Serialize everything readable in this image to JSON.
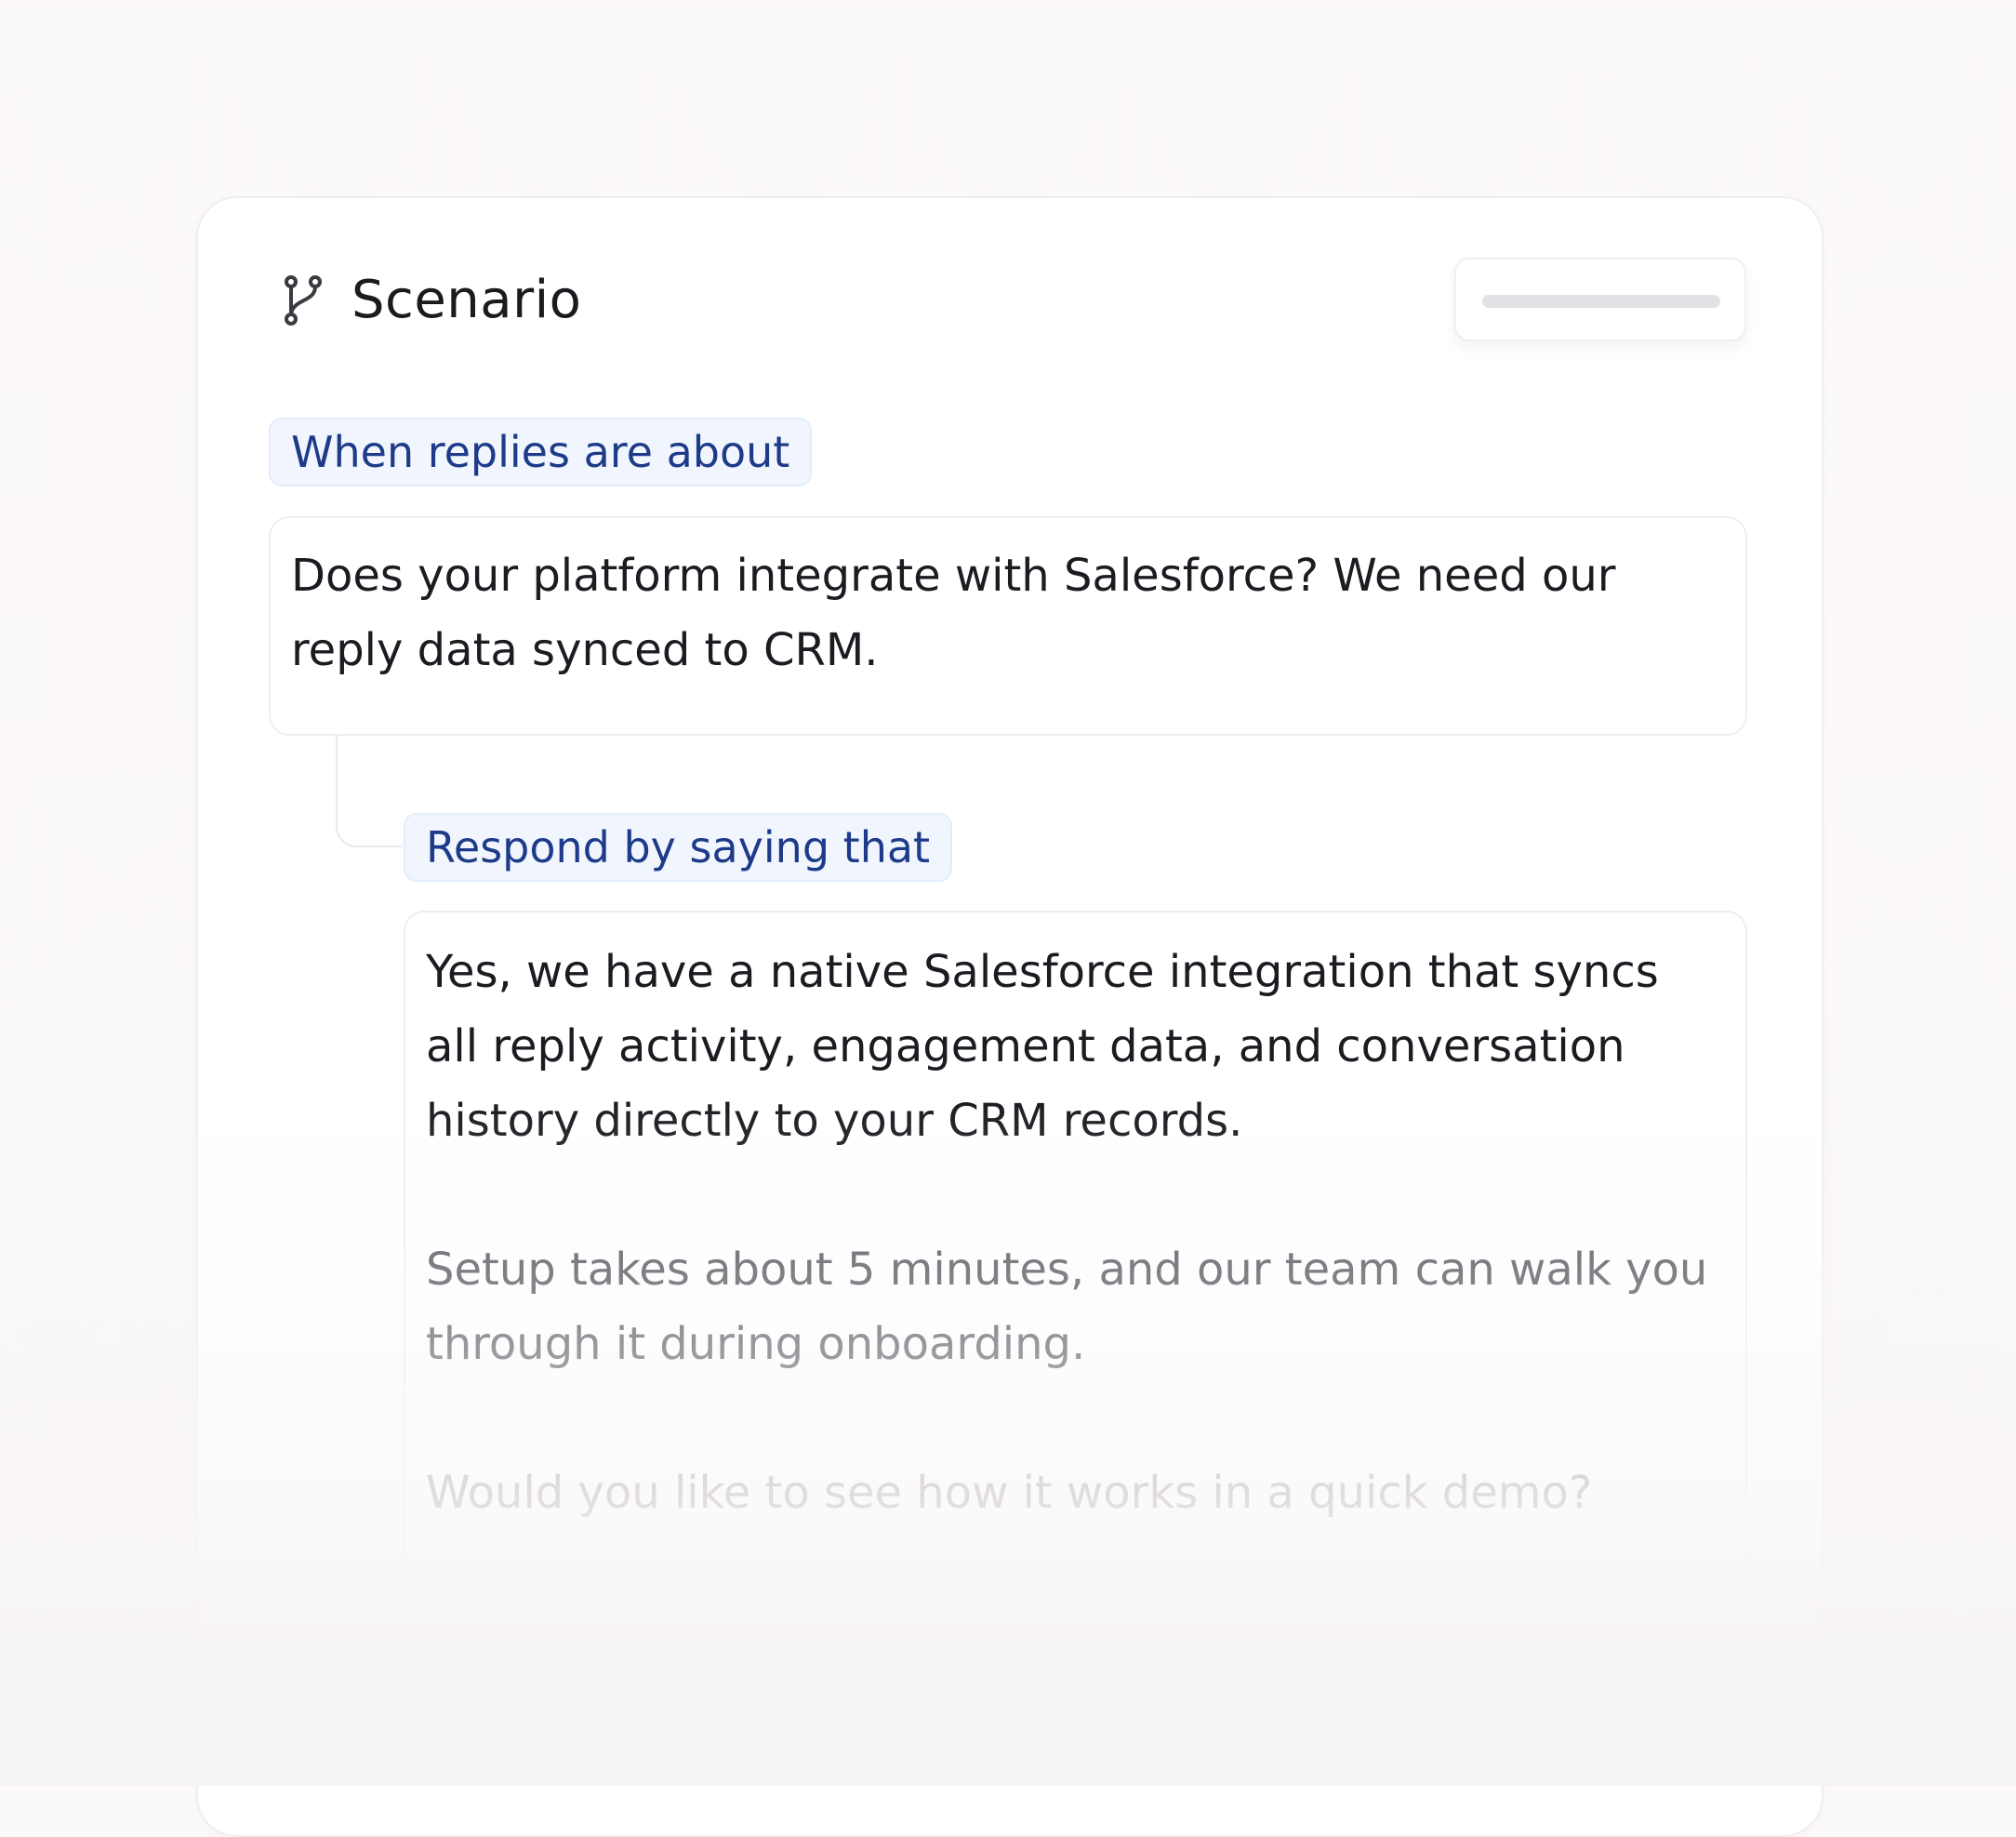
{
  "scenario": {
    "title": "Scenario",
    "icon": "git-branch-icon",
    "trigger_label": "When replies are about",
    "trigger_text": "Does your platform integrate with Salesforce? We need our reply data synced to CRM.",
    "response_label": "Respond by saying that",
    "response_paragraphs": [
      "Yes, we have a native Salesforce integration that syncs all reply activity, engagement data, and conversation history directly to your CRM records.",
      "Setup takes about 5 minutes, and our team can walk you through it during onboarding.",
      "Would you like to see how it works in a quick demo?"
    ]
  },
  "colors": {
    "pill_background": "#f1f6fe",
    "pill_text": "#1e3b8a",
    "body_text": "#1b1b21",
    "page_background": "#fcf9f9"
  }
}
